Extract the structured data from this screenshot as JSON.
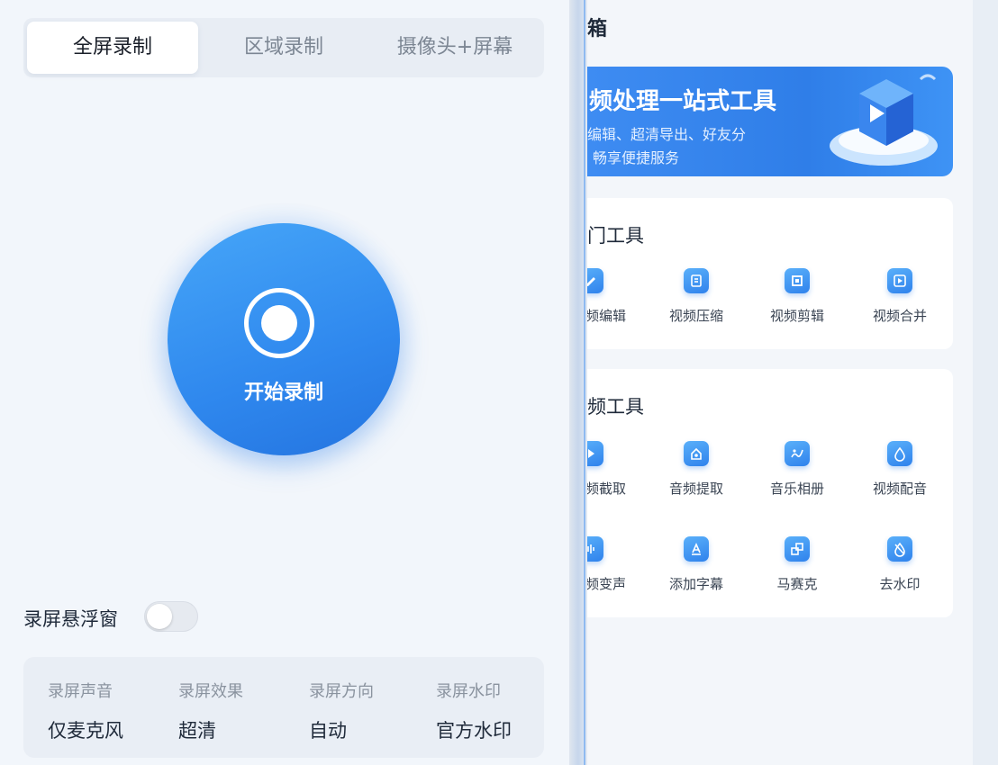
{
  "recorder": {
    "tabs": [
      "全屏录制",
      "区域录制",
      "摄像头+屏幕"
    ],
    "record_button_label": "开始录制",
    "float_window_label": "录屏悬浮窗",
    "float_window_enabled": false,
    "settings": [
      {
        "title": "录屏声音",
        "value": "仅麦克风"
      },
      {
        "title": "录屏效果",
        "value": "超清"
      },
      {
        "title": "录屏方向",
        "value": "自动"
      },
      {
        "title": "录屏水印",
        "value": "官方水印"
      }
    ]
  },
  "toolbox": {
    "title": "箱",
    "banner": {
      "title": "频处理一站式工具",
      "line1": "编辑、超清导出、好友分",
      "line2": "畅享便捷服务"
    },
    "hot_tools": {
      "title": "门工具",
      "items": [
        {
          "label": "频编辑",
          "icon": "edit-icon"
        },
        {
          "label": "视频压缩",
          "icon": "compress-icon"
        },
        {
          "label": "视频剪辑",
          "icon": "crop-icon"
        },
        {
          "label": "视频合并",
          "icon": "merge-icon"
        }
      ]
    },
    "audio_tools": {
      "title": "频工具",
      "items": [
        {
          "label": "频截取",
          "icon": "clip-icon"
        },
        {
          "label": "音频提取",
          "icon": "extract-icon"
        },
        {
          "label": "音乐相册",
          "icon": "music-album-icon"
        },
        {
          "label": "视频配音",
          "icon": "dub-icon"
        },
        {
          "label": "频变声",
          "icon": "voice-change-icon"
        },
        {
          "label": "添加字幕",
          "icon": "subtitle-icon"
        },
        {
          "label": "马赛克",
          "icon": "mosaic-icon"
        },
        {
          "label": "去水印",
          "icon": "remove-watermark-icon"
        }
      ]
    }
  },
  "colors": {
    "accent": "#2f88ee",
    "background": "#f2f6fb"
  }
}
